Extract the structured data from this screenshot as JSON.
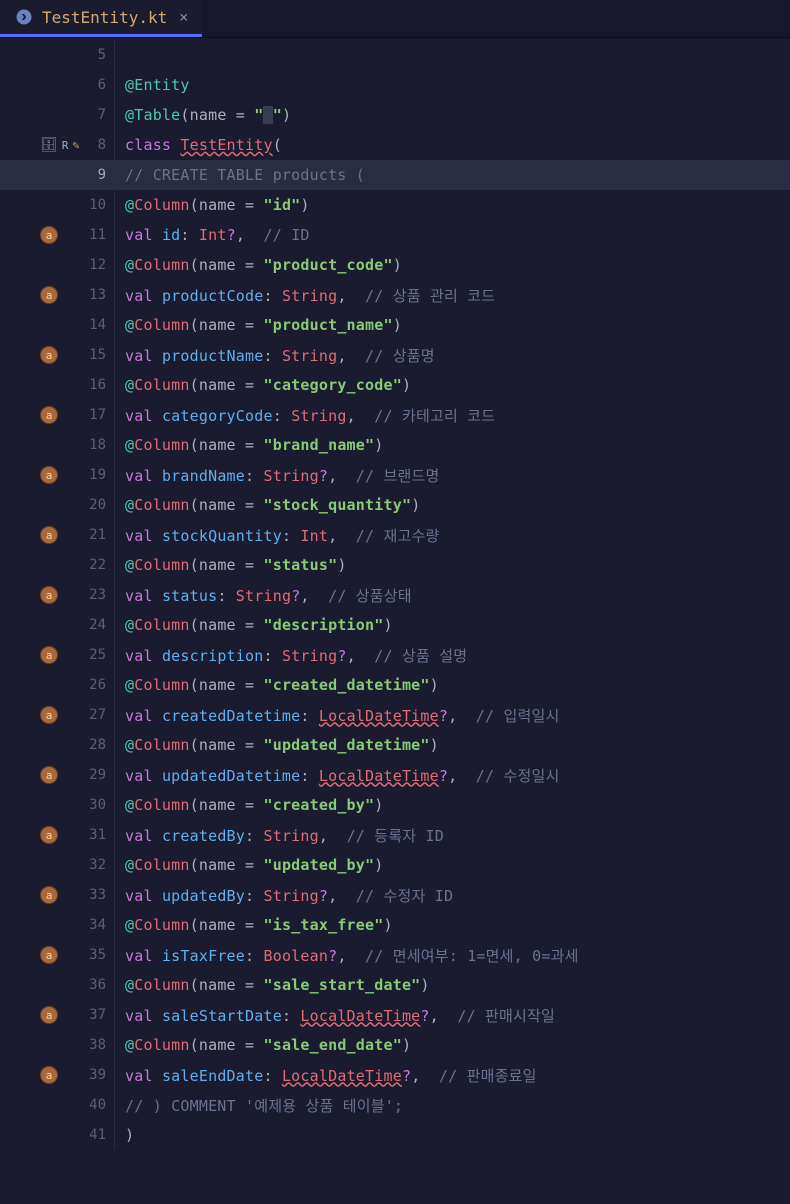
{
  "tab": {
    "filename": "TestEntity.kt"
  },
  "lines": [
    {
      "n": 5,
      "badge": false,
      "icons": "",
      "tokens": []
    },
    {
      "n": 6,
      "badge": false,
      "icons": "",
      "tokens": [
        {
          "t": "@Entity",
          "c": "c-annotation"
        }
      ]
    },
    {
      "n": 7,
      "badge": false,
      "icons": "",
      "tokens": [
        {
          "t": "@Table",
          "c": "c-annotation"
        },
        {
          "t": "(",
          "c": "c-paren"
        },
        {
          "t": "name = ",
          "c": "c-param"
        },
        {
          "t": "\"",
          "c": "c-string"
        },
        {
          "t": " ",
          "c": "c-cursor-bg"
        },
        {
          "t": "\"",
          "c": "c-string"
        },
        {
          "t": ")",
          "c": "c-paren"
        }
      ]
    },
    {
      "n": 8,
      "badge": false,
      "icons": "db",
      "tokens": [
        {
          "t": "class ",
          "c": "c-keyword"
        },
        {
          "t": "TestEntity",
          "c": "c-class-err"
        },
        {
          "t": "(",
          "c": "c-paren"
        }
      ]
    },
    {
      "n": 9,
      "badge": false,
      "icons": "",
      "active": true,
      "tokens": [
        {
          "t": "// CREATE TABLE products (",
          "c": "c-comment"
        }
      ]
    },
    {
      "n": 10,
      "badge": false,
      "icons": "",
      "tokens": [
        {
          "t": "@",
          "c": "c-annotation"
        },
        {
          "t": "Column",
          "c": "c-annotation-name"
        },
        {
          "t": "(",
          "c": "c-paren"
        },
        {
          "t": "name = ",
          "c": "c-param"
        },
        {
          "t": "\"id\"",
          "c": "c-string"
        },
        {
          "t": ")",
          "c": "c-paren"
        }
      ]
    },
    {
      "n": 11,
      "badge": true,
      "icons": "",
      "tokens": [
        {
          "t": "val ",
          "c": "c-keyword"
        },
        {
          "t": "id",
          "c": "c-prop"
        },
        {
          "t": ": ",
          "c": "c-paren"
        },
        {
          "t": "Int",
          "c": "c-type"
        },
        {
          "t": "?",
          "c": "c-q"
        },
        {
          "t": ",",
          "c": "c-comma"
        },
        {
          "t": "  // ID",
          "c": "c-comment"
        }
      ]
    },
    {
      "n": 12,
      "badge": false,
      "icons": "",
      "tokens": [
        {
          "t": "@",
          "c": "c-annotation"
        },
        {
          "t": "Column",
          "c": "c-annotation-name"
        },
        {
          "t": "(",
          "c": "c-paren"
        },
        {
          "t": "name = ",
          "c": "c-param"
        },
        {
          "t": "\"product_code\"",
          "c": "c-string"
        },
        {
          "t": ")",
          "c": "c-paren"
        }
      ]
    },
    {
      "n": 13,
      "badge": true,
      "icons": "",
      "tokens": [
        {
          "t": "val ",
          "c": "c-keyword"
        },
        {
          "t": "productCode",
          "c": "c-prop"
        },
        {
          "t": ": ",
          "c": "c-paren"
        },
        {
          "t": "String",
          "c": "c-type"
        },
        {
          "t": ",",
          "c": "c-comma"
        },
        {
          "t": "  // 상품 관리 코드",
          "c": "c-comment"
        }
      ]
    },
    {
      "n": 14,
      "badge": false,
      "icons": "",
      "tokens": [
        {
          "t": "@",
          "c": "c-annotation"
        },
        {
          "t": "Column",
          "c": "c-annotation-name"
        },
        {
          "t": "(",
          "c": "c-paren"
        },
        {
          "t": "name = ",
          "c": "c-param"
        },
        {
          "t": "\"product_name\"",
          "c": "c-string"
        },
        {
          "t": ")",
          "c": "c-paren"
        }
      ]
    },
    {
      "n": 15,
      "badge": true,
      "icons": "",
      "tokens": [
        {
          "t": "val ",
          "c": "c-keyword"
        },
        {
          "t": "productName",
          "c": "c-prop"
        },
        {
          "t": ": ",
          "c": "c-paren"
        },
        {
          "t": "String",
          "c": "c-type"
        },
        {
          "t": ",",
          "c": "c-comma"
        },
        {
          "t": "  // 상품명",
          "c": "c-comment"
        }
      ]
    },
    {
      "n": 16,
      "badge": false,
      "icons": "",
      "tokens": [
        {
          "t": "@",
          "c": "c-annotation"
        },
        {
          "t": "Column",
          "c": "c-annotation-name"
        },
        {
          "t": "(",
          "c": "c-paren"
        },
        {
          "t": "name = ",
          "c": "c-param"
        },
        {
          "t": "\"category_code\"",
          "c": "c-string"
        },
        {
          "t": ")",
          "c": "c-paren"
        }
      ]
    },
    {
      "n": 17,
      "badge": true,
      "icons": "",
      "tokens": [
        {
          "t": "val ",
          "c": "c-keyword"
        },
        {
          "t": "categoryCode",
          "c": "c-prop"
        },
        {
          "t": ": ",
          "c": "c-paren"
        },
        {
          "t": "String",
          "c": "c-type"
        },
        {
          "t": ",",
          "c": "c-comma"
        },
        {
          "t": "  // 카테고리 코드",
          "c": "c-comment"
        }
      ]
    },
    {
      "n": 18,
      "badge": false,
      "icons": "",
      "tokens": [
        {
          "t": "@",
          "c": "c-annotation"
        },
        {
          "t": "Column",
          "c": "c-annotation-name"
        },
        {
          "t": "(",
          "c": "c-paren"
        },
        {
          "t": "name = ",
          "c": "c-param"
        },
        {
          "t": "\"brand_name\"",
          "c": "c-string"
        },
        {
          "t": ")",
          "c": "c-paren"
        }
      ]
    },
    {
      "n": 19,
      "badge": true,
      "icons": "",
      "tokens": [
        {
          "t": "val ",
          "c": "c-keyword"
        },
        {
          "t": "brandName",
          "c": "c-prop"
        },
        {
          "t": ": ",
          "c": "c-paren"
        },
        {
          "t": "String",
          "c": "c-type"
        },
        {
          "t": "?",
          "c": "c-q"
        },
        {
          "t": ",",
          "c": "c-comma"
        },
        {
          "t": "  // 브랜드명",
          "c": "c-comment"
        }
      ]
    },
    {
      "n": 20,
      "badge": false,
      "icons": "",
      "tokens": [
        {
          "t": "@",
          "c": "c-annotation"
        },
        {
          "t": "Column",
          "c": "c-annotation-name"
        },
        {
          "t": "(",
          "c": "c-paren"
        },
        {
          "t": "name = ",
          "c": "c-param"
        },
        {
          "t": "\"stock_quantity\"",
          "c": "c-string"
        },
        {
          "t": ")",
          "c": "c-paren"
        }
      ]
    },
    {
      "n": 21,
      "badge": true,
      "icons": "",
      "tokens": [
        {
          "t": "val ",
          "c": "c-keyword"
        },
        {
          "t": "stockQuantity",
          "c": "c-prop"
        },
        {
          "t": ": ",
          "c": "c-paren"
        },
        {
          "t": "Int",
          "c": "c-type"
        },
        {
          "t": ",",
          "c": "c-comma"
        },
        {
          "t": "  // 재고수량",
          "c": "c-comment"
        }
      ]
    },
    {
      "n": 22,
      "badge": false,
      "icons": "",
      "tokens": [
        {
          "t": "@",
          "c": "c-annotation"
        },
        {
          "t": "Column",
          "c": "c-annotation-name"
        },
        {
          "t": "(",
          "c": "c-paren"
        },
        {
          "t": "name = ",
          "c": "c-param"
        },
        {
          "t": "\"status\"",
          "c": "c-string"
        },
        {
          "t": ")",
          "c": "c-paren"
        }
      ]
    },
    {
      "n": 23,
      "badge": true,
      "icons": "",
      "tokens": [
        {
          "t": "val ",
          "c": "c-keyword"
        },
        {
          "t": "status",
          "c": "c-prop"
        },
        {
          "t": ": ",
          "c": "c-paren"
        },
        {
          "t": "String",
          "c": "c-type"
        },
        {
          "t": "?",
          "c": "c-q"
        },
        {
          "t": ",",
          "c": "c-comma"
        },
        {
          "t": "  // 상품상태",
          "c": "c-comment"
        }
      ]
    },
    {
      "n": 24,
      "badge": false,
      "icons": "",
      "tokens": [
        {
          "t": "@",
          "c": "c-annotation"
        },
        {
          "t": "Column",
          "c": "c-annotation-name"
        },
        {
          "t": "(",
          "c": "c-paren"
        },
        {
          "t": "name = ",
          "c": "c-param"
        },
        {
          "t": "\"description\"",
          "c": "c-string"
        },
        {
          "t": ")",
          "c": "c-paren"
        }
      ]
    },
    {
      "n": 25,
      "badge": true,
      "icons": "",
      "tokens": [
        {
          "t": "val ",
          "c": "c-keyword"
        },
        {
          "t": "description",
          "c": "c-prop"
        },
        {
          "t": ": ",
          "c": "c-paren"
        },
        {
          "t": "String",
          "c": "c-type"
        },
        {
          "t": "?",
          "c": "c-q"
        },
        {
          "t": ",",
          "c": "c-comma"
        },
        {
          "t": "  // 상품 설명",
          "c": "c-comment"
        }
      ]
    },
    {
      "n": 26,
      "badge": false,
      "icons": "",
      "tokens": [
        {
          "t": "@",
          "c": "c-annotation"
        },
        {
          "t": "Column",
          "c": "c-annotation-name"
        },
        {
          "t": "(",
          "c": "c-paren"
        },
        {
          "t": "name = ",
          "c": "c-param"
        },
        {
          "t": "\"created_datetime\"",
          "c": "c-string"
        },
        {
          "t": ")",
          "c": "c-paren"
        }
      ]
    },
    {
      "n": 27,
      "badge": true,
      "icons": "",
      "tokens": [
        {
          "t": "val ",
          "c": "c-keyword"
        },
        {
          "t": "createdDatetime",
          "c": "c-prop"
        },
        {
          "t": ": ",
          "c": "c-paren"
        },
        {
          "t": "LocalDateTime",
          "c": "c-type-err"
        },
        {
          "t": "?",
          "c": "c-q"
        },
        {
          "t": ",",
          "c": "c-comma"
        },
        {
          "t": "  // 입력일시",
          "c": "c-comment"
        }
      ]
    },
    {
      "n": 28,
      "badge": false,
      "icons": "",
      "tokens": [
        {
          "t": "@",
          "c": "c-annotation"
        },
        {
          "t": "Column",
          "c": "c-annotation-name"
        },
        {
          "t": "(",
          "c": "c-paren"
        },
        {
          "t": "name = ",
          "c": "c-param"
        },
        {
          "t": "\"updated_datetime\"",
          "c": "c-string"
        },
        {
          "t": ")",
          "c": "c-paren"
        }
      ]
    },
    {
      "n": 29,
      "badge": true,
      "icons": "",
      "tokens": [
        {
          "t": "val ",
          "c": "c-keyword"
        },
        {
          "t": "updatedDatetime",
          "c": "c-prop"
        },
        {
          "t": ": ",
          "c": "c-paren"
        },
        {
          "t": "LocalDateTime",
          "c": "c-type-err"
        },
        {
          "t": "?",
          "c": "c-q"
        },
        {
          "t": ",",
          "c": "c-comma"
        },
        {
          "t": "  // 수정일시",
          "c": "c-comment"
        }
      ]
    },
    {
      "n": 30,
      "badge": false,
      "icons": "",
      "tokens": [
        {
          "t": "@",
          "c": "c-annotation"
        },
        {
          "t": "Column",
          "c": "c-annotation-name"
        },
        {
          "t": "(",
          "c": "c-paren"
        },
        {
          "t": "name = ",
          "c": "c-param"
        },
        {
          "t": "\"created_by\"",
          "c": "c-string"
        },
        {
          "t": ")",
          "c": "c-paren"
        }
      ]
    },
    {
      "n": 31,
      "badge": true,
      "icons": "",
      "tokens": [
        {
          "t": "val ",
          "c": "c-keyword"
        },
        {
          "t": "createdBy",
          "c": "c-prop"
        },
        {
          "t": ": ",
          "c": "c-paren"
        },
        {
          "t": "String",
          "c": "c-type"
        },
        {
          "t": ",",
          "c": "c-comma"
        },
        {
          "t": "  // 등록자 ID",
          "c": "c-comment"
        }
      ]
    },
    {
      "n": 32,
      "badge": false,
      "icons": "",
      "tokens": [
        {
          "t": "@",
          "c": "c-annotation"
        },
        {
          "t": "Column",
          "c": "c-annotation-name"
        },
        {
          "t": "(",
          "c": "c-paren"
        },
        {
          "t": "name = ",
          "c": "c-param"
        },
        {
          "t": "\"updated_by\"",
          "c": "c-string"
        },
        {
          "t": ")",
          "c": "c-paren"
        }
      ]
    },
    {
      "n": 33,
      "badge": true,
      "icons": "",
      "tokens": [
        {
          "t": "val ",
          "c": "c-keyword"
        },
        {
          "t": "updatedBy",
          "c": "c-prop"
        },
        {
          "t": ": ",
          "c": "c-paren"
        },
        {
          "t": "String",
          "c": "c-type"
        },
        {
          "t": "?",
          "c": "c-q"
        },
        {
          "t": ",",
          "c": "c-comma"
        },
        {
          "t": "  // 수정자 ID",
          "c": "c-comment"
        }
      ]
    },
    {
      "n": 34,
      "badge": false,
      "icons": "",
      "tokens": [
        {
          "t": "@",
          "c": "c-annotation"
        },
        {
          "t": "Column",
          "c": "c-annotation-name"
        },
        {
          "t": "(",
          "c": "c-paren"
        },
        {
          "t": "name = ",
          "c": "c-param"
        },
        {
          "t": "\"is_tax_free\"",
          "c": "c-string"
        },
        {
          "t": ")",
          "c": "c-paren"
        }
      ]
    },
    {
      "n": 35,
      "badge": true,
      "icons": "",
      "tokens": [
        {
          "t": "val ",
          "c": "c-keyword"
        },
        {
          "t": "isTaxFree",
          "c": "c-prop"
        },
        {
          "t": ": ",
          "c": "c-paren"
        },
        {
          "t": "Boolean",
          "c": "c-type"
        },
        {
          "t": "?",
          "c": "c-q"
        },
        {
          "t": ",",
          "c": "c-comma"
        },
        {
          "t": "  // 면세여부: 1=면세, 0=과세",
          "c": "c-comment"
        }
      ]
    },
    {
      "n": 36,
      "badge": false,
      "icons": "",
      "tokens": [
        {
          "t": "@",
          "c": "c-annotation"
        },
        {
          "t": "Column",
          "c": "c-annotation-name"
        },
        {
          "t": "(",
          "c": "c-paren"
        },
        {
          "t": "name = ",
          "c": "c-param"
        },
        {
          "t": "\"sale_start_date\"",
          "c": "c-string"
        },
        {
          "t": ")",
          "c": "c-paren"
        }
      ]
    },
    {
      "n": 37,
      "badge": true,
      "icons": "",
      "tokens": [
        {
          "t": "val ",
          "c": "c-keyword"
        },
        {
          "t": "saleStartDate",
          "c": "c-prop"
        },
        {
          "t": ": ",
          "c": "c-paren"
        },
        {
          "t": "LocalDateTime",
          "c": "c-type-err"
        },
        {
          "t": "?",
          "c": "c-q"
        },
        {
          "t": ",",
          "c": "c-comma"
        },
        {
          "t": "  // 판매시작일",
          "c": "c-comment"
        }
      ]
    },
    {
      "n": 38,
      "badge": false,
      "icons": "",
      "tokens": [
        {
          "t": "@",
          "c": "c-annotation"
        },
        {
          "t": "Column",
          "c": "c-annotation-name"
        },
        {
          "t": "(",
          "c": "c-paren"
        },
        {
          "t": "name = ",
          "c": "c-param"
        },
        {
          "t": "\"sale_end_date\"",
          "c": "c-string"
        },
        {
          "t": ")",
          "c": "c-paren"
        }
      ]
    },
    {
      "n": 39,
      "badge": true,
      "icons": "",
      "tokens": [
        {
          "t": "val ",
          "c": "c-keyword"
        },
        {
          "t": "saleEndDate",
          "c": "c-prop"
        },
        {
          "t": ": ",
          "c": "c-paren"
        },
        {
          "t": "LocalDateTime",
          "c": "c-type-err"
        },
        {
          "t": "?",
          "c": "c-q"
        },
        {
          "t": ",",
          "c": "c-comma"
        },
        {
          "t": "  // 판매종료일",
          "c": "c-comment"
        }
      ]
    },
    {
      "n": 40,
      "badge": false,
      "icons": "",
      "tokens": [
        {
          "t": "// ) COMMENT '예제용 상품 테이블';",
          "c": "c-comment"
        }
      ]
    },
    {
      "n": 41,
      "badge": false,
      "icons": "",
      "tokens": [
        {
          "t": ")",
          "c": "c-paren"
        }
      ]
    }
  ]
}
